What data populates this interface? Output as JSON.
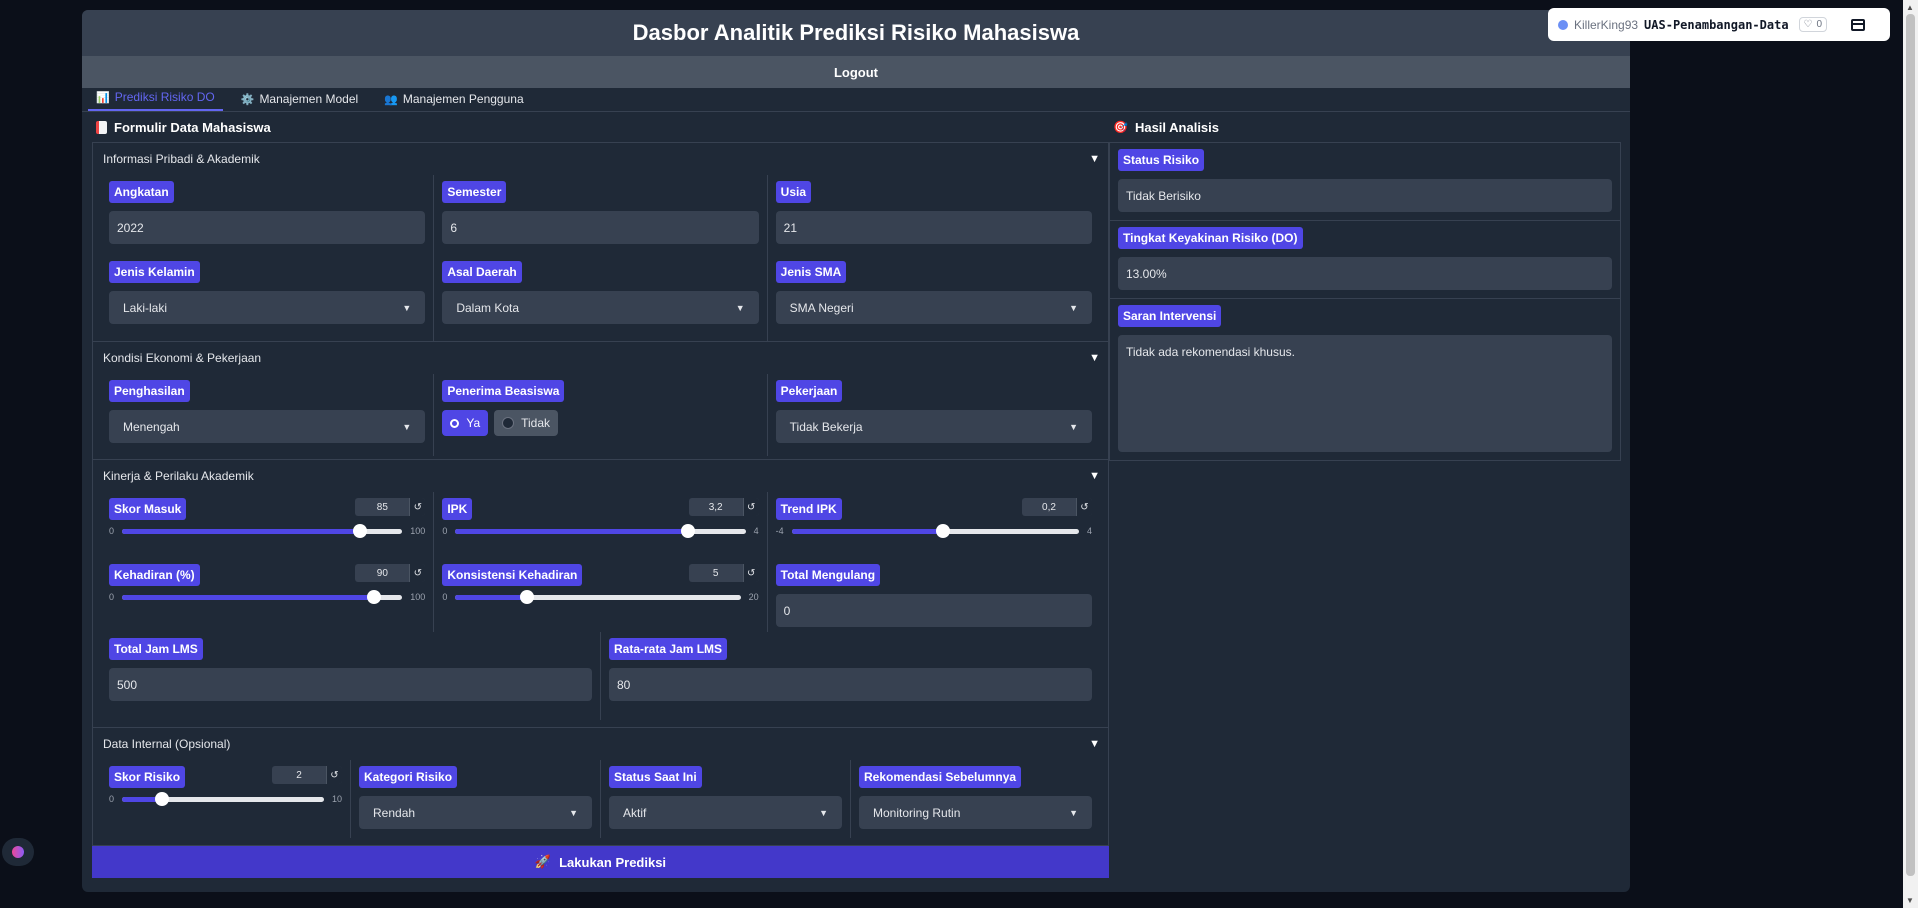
{
  "app": {
    "title": "Dasbor Analitik Prediksi Risiko Mahasiswa",
    "logout_label": "Logout"
  },
  "tabs": [
    {
      "label": "Prediksi Risiko DO",
      "icon": "chart-icon",
      "active": true
    },
    {
      "label": "Manajemen Model",
      "icon": "gear-icon",
      "active": false
    },
    {
      "label": "Manajemen Pengguna",
      "icon": "users-icon",
      "active": false
    }
  ],
  "form": {
    "title": "Formulir Data Mahasiswa",
    "sections": {
      "personal": {
        "title": "Informasi Pribadi & Akademik",
        "angkatan": {
          "label": "Angkatan",
          "value": "2022"
        },
        "semester": {
          "label": "Semester",
          "value": "6"
        },
        "usia": {
          "label": "Usia",
          "value": "21"
        },
        "jenis_kelamin": {
          "label": "Jenis Kelamin",
          "value": "Laki-laki"
        },
        "asal_daerah": {
          "label": "Asal Daerah",
          "value": "Dalam Kota"
        },
        "jenis_sma": {
          "label": "Jenis SMA",
          "value": "SMA Negeri"
        }
      },
      "economy": {
        "title": "Kondisi Ekonomi & Pekerjaan",
        "penghasilan": {
          "label": "Penghasilan",
          "value": "Menengah"
        },
        "beasiswa": {
          "label": "Penerima Beasiswa",
          "options": [
            "Ya",
            "Tidak"
          ],
          "selected": "Ya"
        },
        "pekerjaan": {
          "label": "Pekerjaan",
          "value": "Tidak Bekerja"
        }
      },
      "performance": {
        "title": "Kinerja & Perilaku Akademik",
        "skor_masuk": {
          "label": "Skor Masuk",
          "value": "85",
          "min": "0",
          "max": "100",
          "fraction": 0.85
        },
        "ipk": {
          "label": "IPK",
          "value": "3,2",
          "min": "0",
          "max": "4",
          "fraction": 0.8
        },
        "trend_ipk": {
          "label": "Trend IPK",
          "value": "0,2",
          "min": "-4",
          "max": "4",
          "fraction": 0.525
        },
        "kehadiran": {
          "label": "Kehadiran (%)",
          "value": "90",
          "min": "0",
          "max": "100",
          "fraction": 0.9
        },
        "konsistensi": {
          "label": "Konsistensi Kehadiran",
          "value": "5",
          "min": "0",
          "max": "20",
          "fraction": 0.25
        },
        "total_mengulang": {
          "label": "Total Mengulang",
          "value": "0"
        },
        "total_jam_lms": {
          "label": "Total Jam LMS",
          "value": "500"
        },
        "rata_jam_lms": {
          "label": "Rata-rata Jam LMS",
          "value": "80"
        }
      },
      "internal": {
        "title": "Data Internal (Opsional)",
        "skor_risiko": {
          "label": "Skor Risiko",
          "value": "2",
          "min": "0",
          "max": "10",
          "fraction": 0.2
        },
        "kategori_risiko": {
          "label": "Kategori Risiko",
          "value": "Rendah"
        },
        "status_saat_ini": {
          "label": "Status Saat Ini",
          "value": "Aktif"
        },
        "rekomendasi": {
          "label": "Rekomendasi Sebelumnya",
          "value": "Monitoring Rutin"
        }
      }
    },
    "submit_label": "Lakukan Prediksi"
  },
  "result": {
    "title": "Hasil Analisis",
    "status": {
      "label": "Status Risiko",
      "value": "Tidak Berisiko"
    },
    "confidence": {
      "label": "Tingkat Keyakinan Risiko (DO)",
      "value": "13.00%"
    },
    "intervention": {
      "label": "Saran Intervensi",
      "value": "Tidak ada rekomendasi khusus."
    }
  },
  "space_badge": {
    "user": "KillerKing93",
    "repo": "UAS-Penambangan-Data",
    "likes": "0"
  },
  "colors": {
    "accent": "#4f46e5",
    "panel": "#1f2937",
    "input": "#374151",
    "background": "#0b0f19"
  }
}
